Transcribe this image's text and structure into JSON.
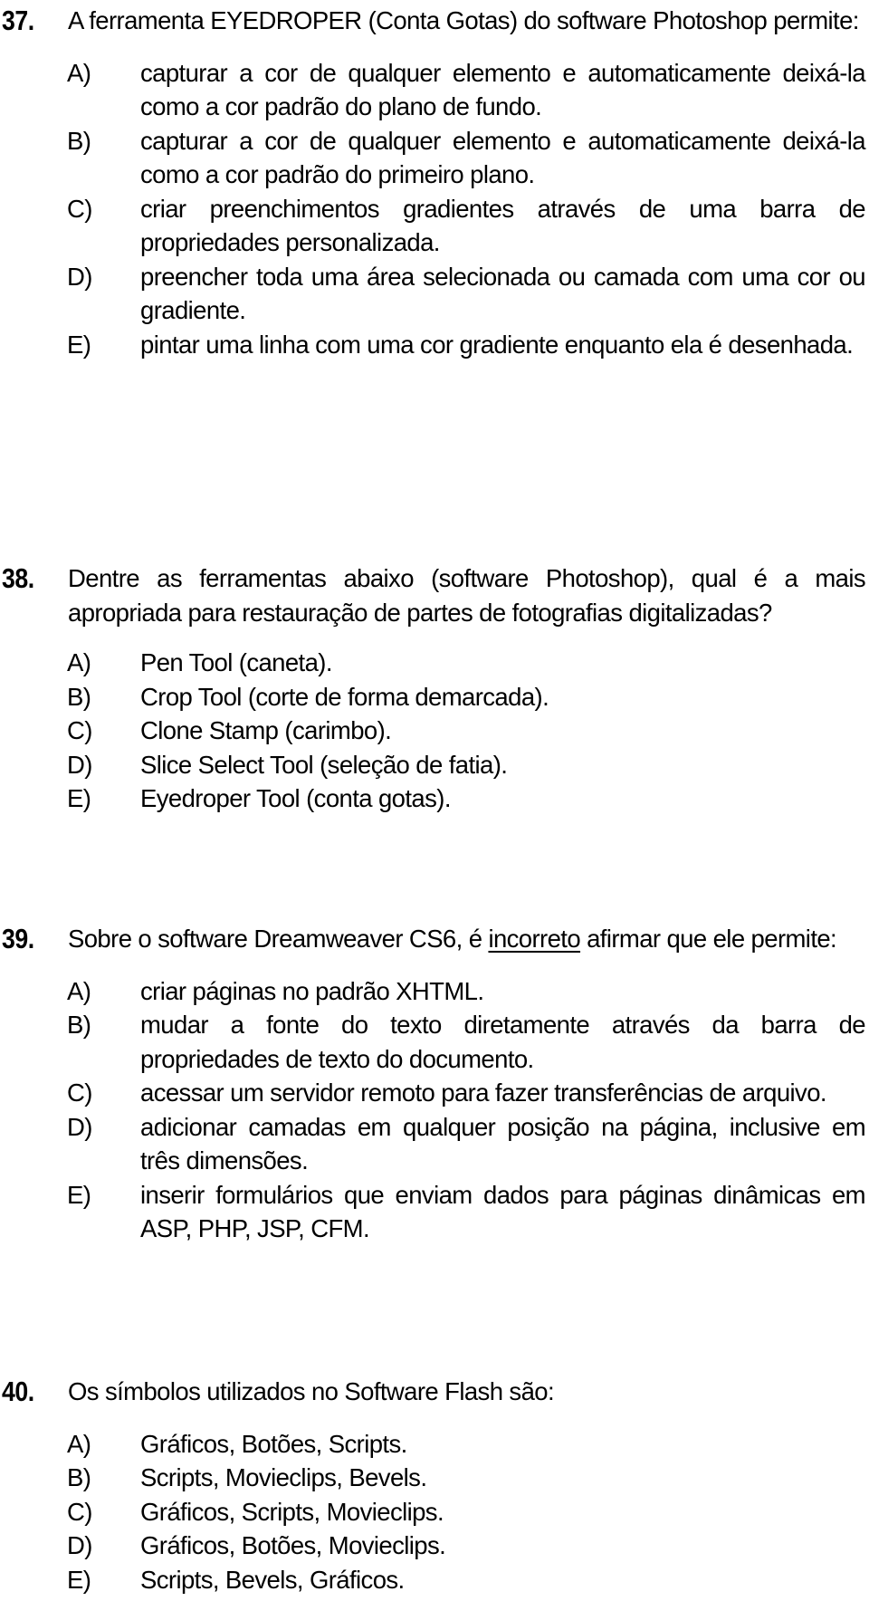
{
  "questions": [
    {
      "number": "37.",
      "text": "A ferramenta EYEDROPER (Conta Gotas) do software Photoshop permite:",
      "options": [
        {
          "letter": "A)",
          "text": "capturar a cor de qualquer elemento e automaticamente deixá-la como a cor padrão do plano de fundo."
        },
        {
          "letter": "B)",
          "text": "capturar a cor de qualquer elemento e automaticamente deixá-la como a cor padrão do primeiro plano."
        },
        {
          "letter": "C)",
          "text": "criar preenchimentos gradientes através de uma barra de propriedades personalizada."
        },
        {
          "letter": "D)",
          "text": "preencher toda uma área selecionada ou camada com uma cor ou gradiente."
        },
        {
          "letter": "E)",
          "text": "pintar uma linha com uma cor gradiente enquanto ela é desenhada."
        }
      ]
    },
    {
      "number": "38.",
      "text": "Dentre as ferramentas abaixo (software Photoshop), qual é a mais apropriada para restauração de partes de fotografias digitalizadas?",
      "options": [
        {
          "letter": "A)",
          "text": "Pen Tool (caneta)."
        },
        {
          "letter": "B)",
          "text": "Crop Tool (corte de forma demarcada)."
        },
        {
          "letter": "C)",
          "text": "Clone Stamp (carimbo)."
        },
        {
          "letter": "D)",
          "text": "Slice Select Tool (seleção de fatia)."
        },
        {
          "letter": "E)",
          "text": "Eyedroper Tool (conta gotas)."
        }
      ]
    },
    {
      "number": "39.",
      "text_before": "Sobre o software Dreamweaver CS6, é ",
      "text_underlined": "incorreto",
      "text_after": " afirmar que ele permite:",
      "options": [
        {
          "letter": "A)",
          "text": "criar páginas no padrão XHTML."
        },
        {
          "letter": "B)",
          "text": "mudar a fonte do texto diretamente através da barra de propriedades de texto do documento."
        },
        {
          "letter": "C)",
          "text": "acessar um servidor remoto para fazer transferências de arquivo."
        },
        {
          "letter": "D)",
          "text": "adicionar camadas em qualquer posição na página, inclusive em três dimensões."
        },
        {
          "letter": "E)",
          "text": "inserir formulários que enviam dados para páginas dinâmicas em ASP, PHP, JSP, CFM."
        }
      ]
    },
    {
      "number": "40.",
      "text": "Os símbolos utilizados no Software Flash são:",
      "options": [
        {
          "letter": "A)",
          "text": "Gráficos, Botões, Scripts."
        },
        {
          "letter": "B)",
          "text": "Scripts, Movieclips, Bevels."
        },
        {
          "letter": "C)",
          "text": "Gráficos, Scripts, Movieclips."
        },
        {
          "letter": "D)",
          "text": "Gráficos, Botões, Movieclips."
        },
        {
          "letter": "E)",
          "text": "Scripts, Bevels, Gráficos."
        }
      ]
    }
  ]
}
